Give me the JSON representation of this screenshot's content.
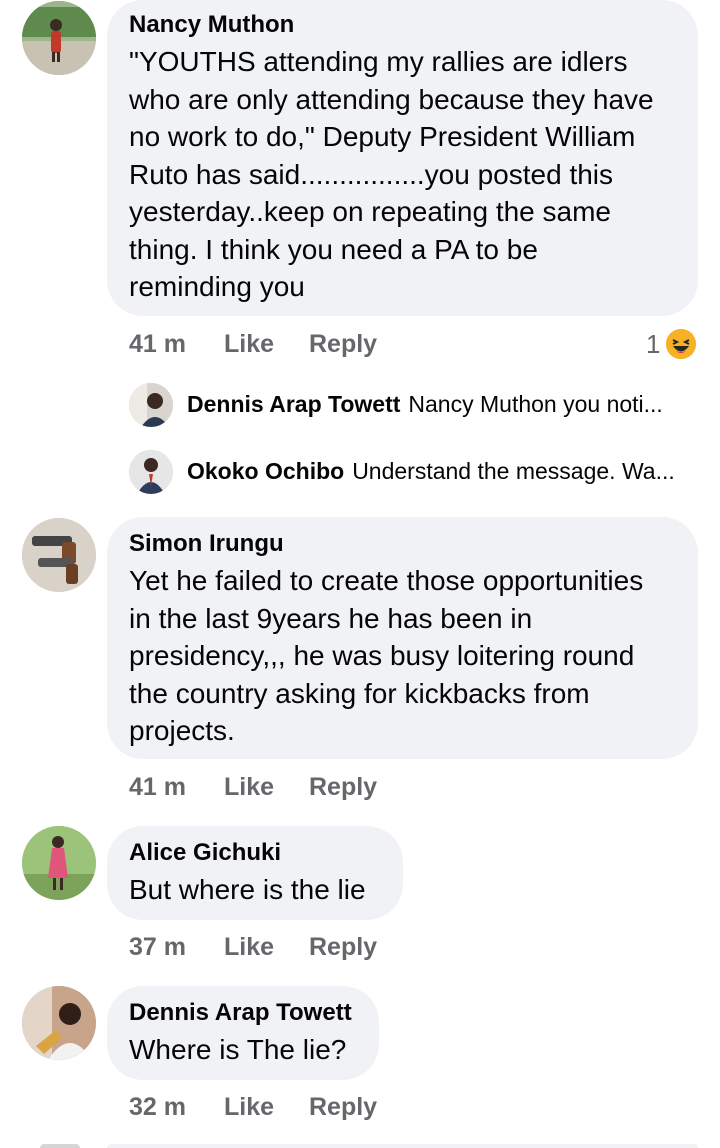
{
  "comments": [
    {
      "author": "Nancy Muthon",
      "lines": [
        "\"YOUTHS attending my rallies are idlers",
        "who are only attending because they have",
        "no work to do,\" Deputy President William",
        "Ruto has said................you posted this",
        "yesterday..keep on repeating the same",
        "thing.  I think you need a PA to be",
        "reminding you"
      ],
      "time": "41 m",
      "like": "Like",
      "reply": "Reply",
      "reaction_count": "1",
      "reaction_icon": "haha-emoji-icon",
      "replies": [
        {
          "author": "Dennis Arap Towett",
          "preview": "Nancy Muthon you noti..."
        },
        {
          "author": "Okoko Ochibo",
          "preview": "Understand the message. Wa..."
        }
      ]
    },
    {
      "author": "Simon Irungu",
      "lines": [
        "Yet he failed to create those opportunities",
        "in the last 9years he has been in",
        "presidency,,, he was busy loitering round",
        "the country asking for kickbacks from",
        "projects."
      ],
      "time": "41 m",
      "like": "Like",
      "reply": "Reply"
    },
    {
      "author": "Alice Gichuki",
      "lines": [
        "But where is the lie"
      ],
      "time": "37 m",
      "like": "Like",
      "reply": "Reply"
    },
    {
      "author": "Dennis Arap Towett",
      "lines": [
        "Where is The lie?"
      ],
      "time": "32 m",
      "like": "Like",
      "reply": "Reply"
    }
  ],
  "colors": {
    "bubble": "#f0f2f5",
    "meta_text": "#65676b",
    "reaction": "#f7b125"
  }
}
